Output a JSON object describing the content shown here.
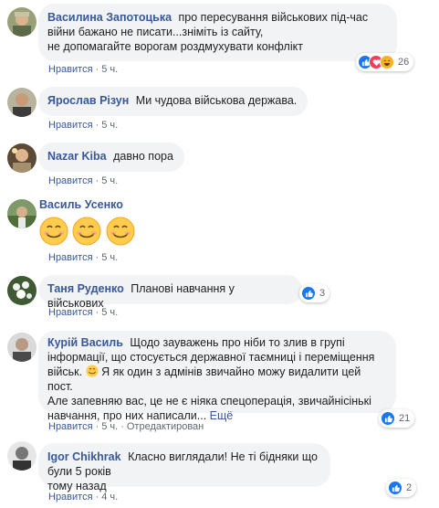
{
  "comments": [
    {
      "author": "Василина Запотоцька",
      "text_lines": [
        "про пересування військових під-час",
        "війни бажано не писати...зніміть із сайту,",
        "не допомагайте ворогам роздмухувати конфлікт"
      ],
      "like_label": "Нравится",
      "time": "5 ч.",
      "reaction_count": "26",
      "reaction_icons": [
        "like-icon",
        "love-icon",
        "haha-icon"
      ]
    },
    {
      "author": "Ярослав Різун",
      "text": "Ми чудова військова держава.",
      "like_label": "Нравится",
      "time": "5 ч."
    },
    {
      "author": "Nazar Kiba",
      "text": "давно пора",
      "like_label": "Нравится",
      "time": "5 ч."
    },
    {
      "author": "Василь Усенко",
      "emoji": [
        "smile-emoji",
        "smile-emoji",
        "smile-emoji"
      ],
      "like_label": "Нравится",
      "time": "5 ч."
    },
    {
      "author": "Таня Руденко",
      "text": "Планові навчання у військових",
      "like_label": "Нравится",
      "time": "5 ч.",
      "reaction_count": "3",
      "reaction_icons": [
        "like-icon"
      ]
    },
    {
      "author": "Курій Василь",
      "text_lines": [
        "Щодо зауважень про ніби то злив в групі",
        "інформації, що стосується державної таємниці і переміщення",
        "військ.",
        "Я як один з адмінів звичайно можу видалити цей пост.",
        "Але запевняю вас, це не є ніяка спецоперація, звичайнісінькі",
        "навчання, про них написали..."
      ],
      "more_label": "Ещё",
      "like_label": "Нравится",
      "time": "5 ч.",
      "edited_label": "Отредактирован",
      "reaction_count": "21",
      "reaction_icons": [
        "like-icon"
      ]
    },
    {
      "author": "Igor Chikhrak",
      "text_lines": [
        "Класно виглядали! Не ті бідняки що були 5 років",
        "тому назад"
      ],
      "like_label": "Нравится",
      "time": "4 ч.",
      "reaction_count": "2",
      "reaction_icons": [
        "like-icon"
      ]
    }
  ],
  "colors": {
    "author": "#385898",
    "bubble": "#f2f3f5",
    "meta": "#606770",
    "like_reaction": "#1877f2",
    "love_reaction": "#f33e58",
    "haha_reaction": "#f7b125"
  }
}
